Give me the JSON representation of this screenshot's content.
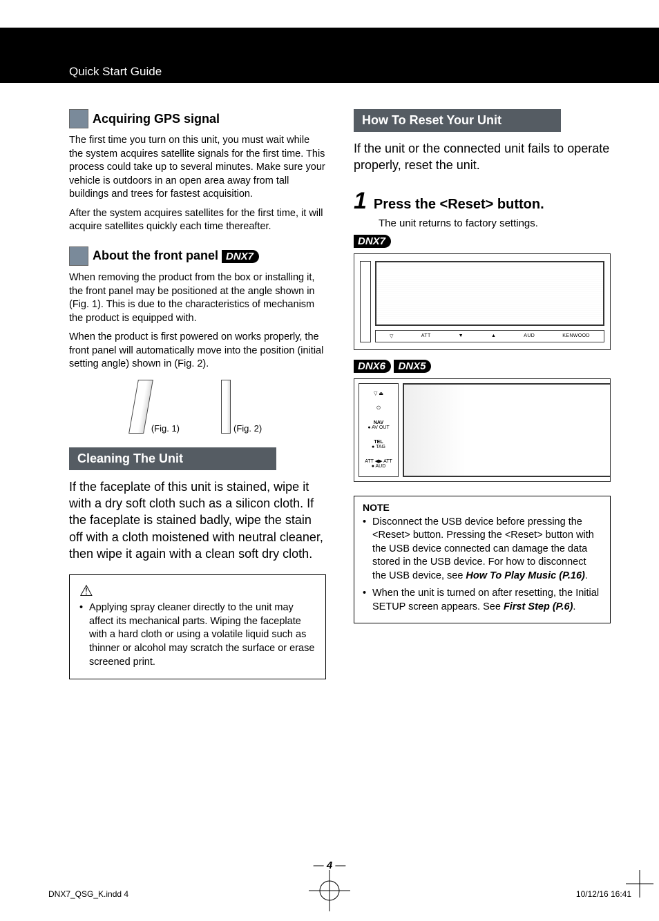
{
  "header": {
    "title": "Quick Start Guide"
  },
  "col1": {
    "h1": "Acquiring GPS signal",
    "p1": "The first time you turn on this unit, you must wait while the system acquires satellite signals for the first time. This process could take up to several minutes. Make sure your vehicle is outdoors in an open area away from tall buildings and trees for fastest acquisition.",
    "p2": "After the system acquires satellites for the first time, it will acquire satellites quickly each time thereafter.",
    "h2_pre": "About the front panel ",
    "h2_tag": "DNX7",
    "p3": "When removing the product from the box or installing it, the front panel may be positioned at the angle shown in (Fig. 1). This is due to the characteristics of mechanism the product is equipped with.",
    "p4": "When the product is first powered on works properly, the front panel will automatically move into the position (initial setting angle) shown in (Fig. 2).",
    "fig1": "(Fig. 1)",
    "fig2": "(Fig. 2)",
    "bar1": "Cleaning The Unit",
    "p5": "If the faceplate of this unit is stained, wipe it with a dry soft cloth such as a silicon cloth. If the faceplate is stained badly, wipe the stain off with a cloth moistened with neutral cleaner, then wipe it again with a clean soft dry cloth.",
    "caution": "Applying spray cleaner directly to the unit may affect its mechanical parts. Wiping the faceplate with a hard cloth or using a volatile liquid such as thinner or alcohol may scratch the surface or erase screened print."
  },
  "col2": {
    "bar1": "How To Reset Your Unit",
    "p1": "If the unit or the connected unit fails to operate properly, reset the unit.",
    "step_num": "1",
    "step_txt": "Press the <Reset> button.",
    "step_sub": "The unit returns to factory settings.",
    "tag1": "DNX7",
    "dev1_labels": {
      "a": "▽",
      "b": "ATT",
      "c": "▼",
      "d": "▲",
      "e": "AUD",
      "f": "KENWOOD"
    },
    "tag2a": "DNX6",
    "tag2b": "DNX5",
    "dev2_labels": {
      "a": "▽  ⏏",
      "b": "⏻",
      "c": "NAV",
      "c2": "● AV OUT",
      "d": "TEL",
      "d2": "● TAG",
      "e": "ATT ◀▶ ATT",
      "e2": "● AUD"
    },
    "note_title": "NOTE",
    "note1_a": "Disconnect the USB device before pressing the <Reset> button. Pressing the <Reset> button with the USB device connected can damage the data stored in the USB device. For how to disconnect the USB device, see ",
    "note1_b": "How To Play Music (P.16)",
    "note1_c": ".",
    "note2_a": "When the unit is turned on after resetting, the Initial SETUP screen appears. See  ",
    "note2_b": "First Step (P.6)",
    "note2_c": "."
  },
  "page": {
    "num": "4"
  },
  "footer": {
    "left": "DNX7_QSG_K.indd   4",
    "right": "10/12/16   16:41"
  }
}
